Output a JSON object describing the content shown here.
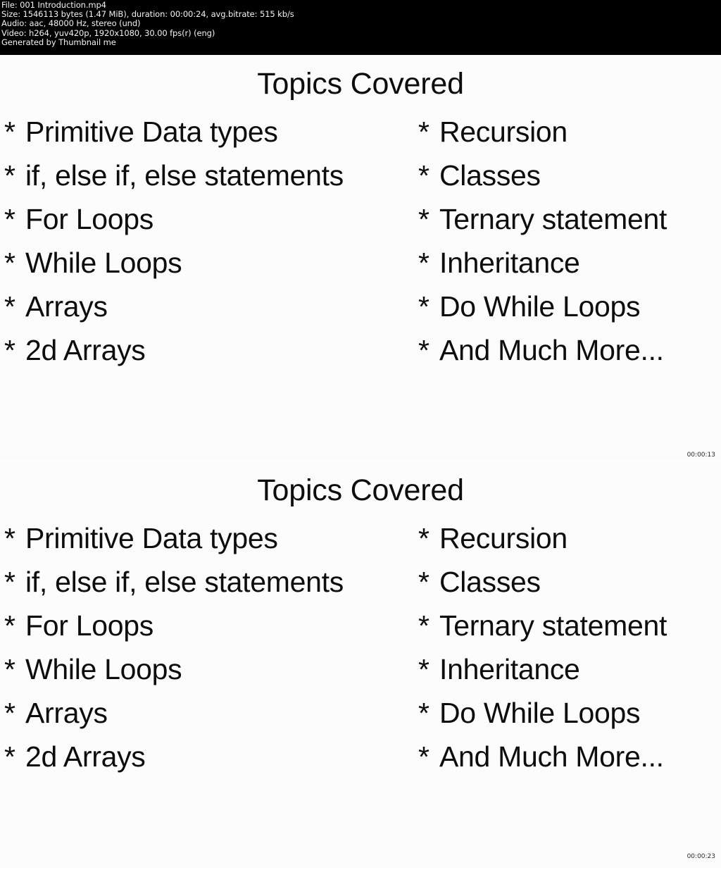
{
  "header": {
    "lines": [
      "File: 001 Introduction.mp4",
      "Size: 1546113 bytes (1.47 MiB), duration: 00:00:24, avg.bitrate: 515 kb/s",
      "Audio: aac, 48000 Hz, stereo (und)",
      "Video: h264, yuv420p, 1920x1080, 30.00 fps(r) (eng)",
      "Generated by Thumbnail me"
    ],
    "file_name": "001 Introduction.mp4",
    "size_bytes": "1546113",
    "size_human": "1.47 MiB",
    "duration": "00:00:24",
    "avg_bitrate": "515 kb/s",
    "audio_codec": "aac",
    "audio_sample_rate": "48000 Hz",
    "audio_channels": "stereo (und)",
    "video_codec": "h264",
    "pixel_format": "yuv420p",
    "resolution": "1920x1080",
    "fps": "30.00 fps(r)",
    "video_language": "(eng)",
    "generator": "Generated by Thumbnail me",
    "background_color": "#000000",
    "text_color": "#f2f2f2"
  },
  "slide": {
    "title": "Topics Covered",
    "star": "*",
    "left_column": [
      "Primitive Data types",
      "if, else if, else statements",
      "For Loops",
      "While Loops",
      "Arrays",
      "2d Arrays"
    ],
    "right_column": [
      "Recursion",
      "Classes",
      "Ternary statement",
      "Inheritance",
      "Do While Loops",
      "And Much More..."
    ],
    "background_color": "#fcfcfc",
    "text_color": "#0d0d0d"
  },
  "thumbnails": [
    {
      "timestamp": "00:00:13"
    },
    {
      "timestamp": "00:00:23"
    }
  ]
}
